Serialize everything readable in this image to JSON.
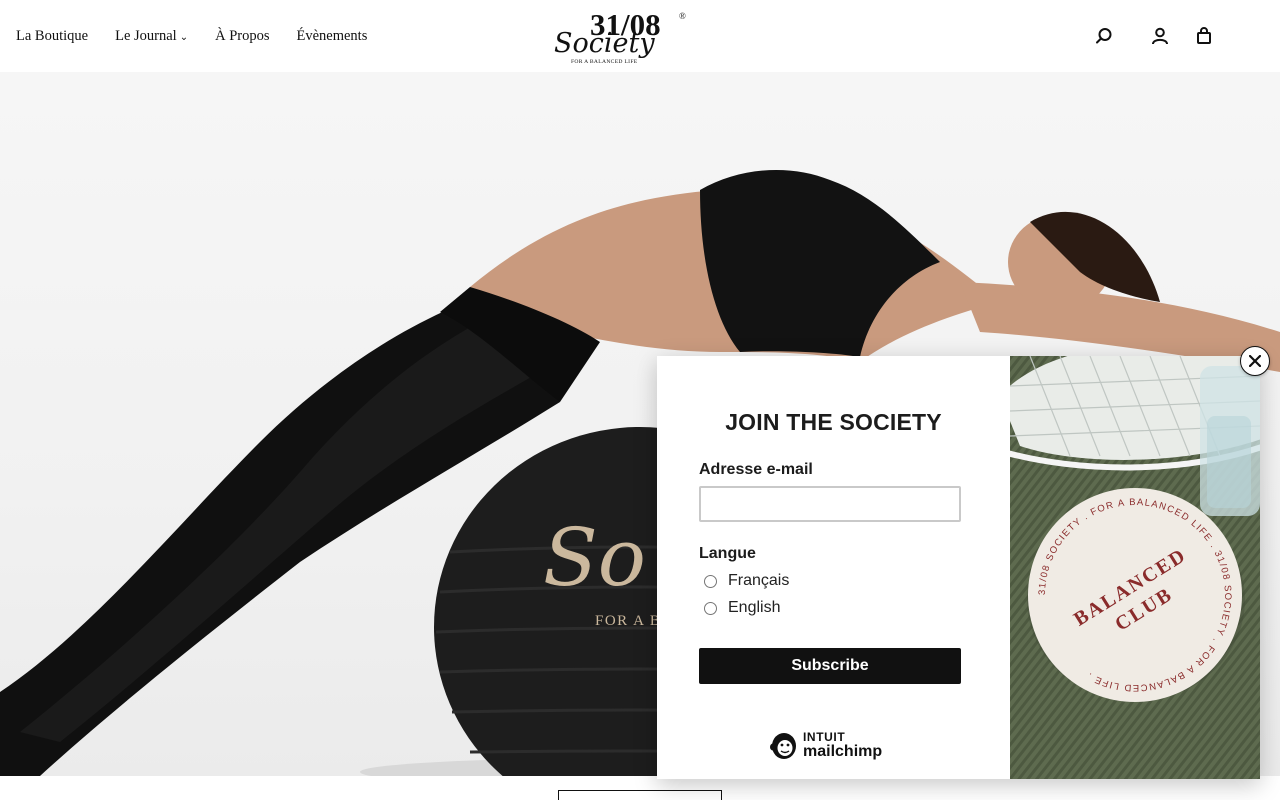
{
  "header": {
    "nav": [
      {
        "label": "La Boutique"
      },
      {
        "label": "Le Journal",
        "has_dropdown": true
      },
      {
        "label": "À Propos"
      },
      {
        "label": "Évènements"
      }
    ],
    "logo": {
      "number": "31/08",
      "wordmark": "Society",
      "tagline": "FOR A BALANCED LIFE",
      "mark": "®"
    },
    "icons": [
      "search-icon",
      "account-icon",
      "cart-icon"
    ]
  },
  "hero": {
    "ball_logo": {
      "script": "So",
      "tagline": "FOR A B"
    }
  },
  "popup": {
    "title": "JOIN THE SOCIETY",
    "email_label": "Adresse e-mail",
    "email_value": "",
    "language_label": "Langue",
    "language_options": [
      "Français",
      "English"
    ],
    "subscribe_label": "Subscribe",
    "badge": {
      "intuit": "INTUIT",
      "brand": "mailchimp"
    },
    "close_icon": "close-icon",
    "photo": {
      "coaster_title_line1": "BALANCED",
      "coaster_title_line2": "CLUB",
      "coaster_ring_text": "31/08 SOCIETY . FOR A BALANCED LIFE . 31/08 SOCIETY . FOR A BALANCED LIFE ."
    }
  },
  "colors": {
    "text": "#111111",
    "button_bg": "#111111",
    "button_text": "#ffffff",
    "coaster_accent": "#8a2b2b",
    "fabric_green": "#5e6b4f"
  }
}
